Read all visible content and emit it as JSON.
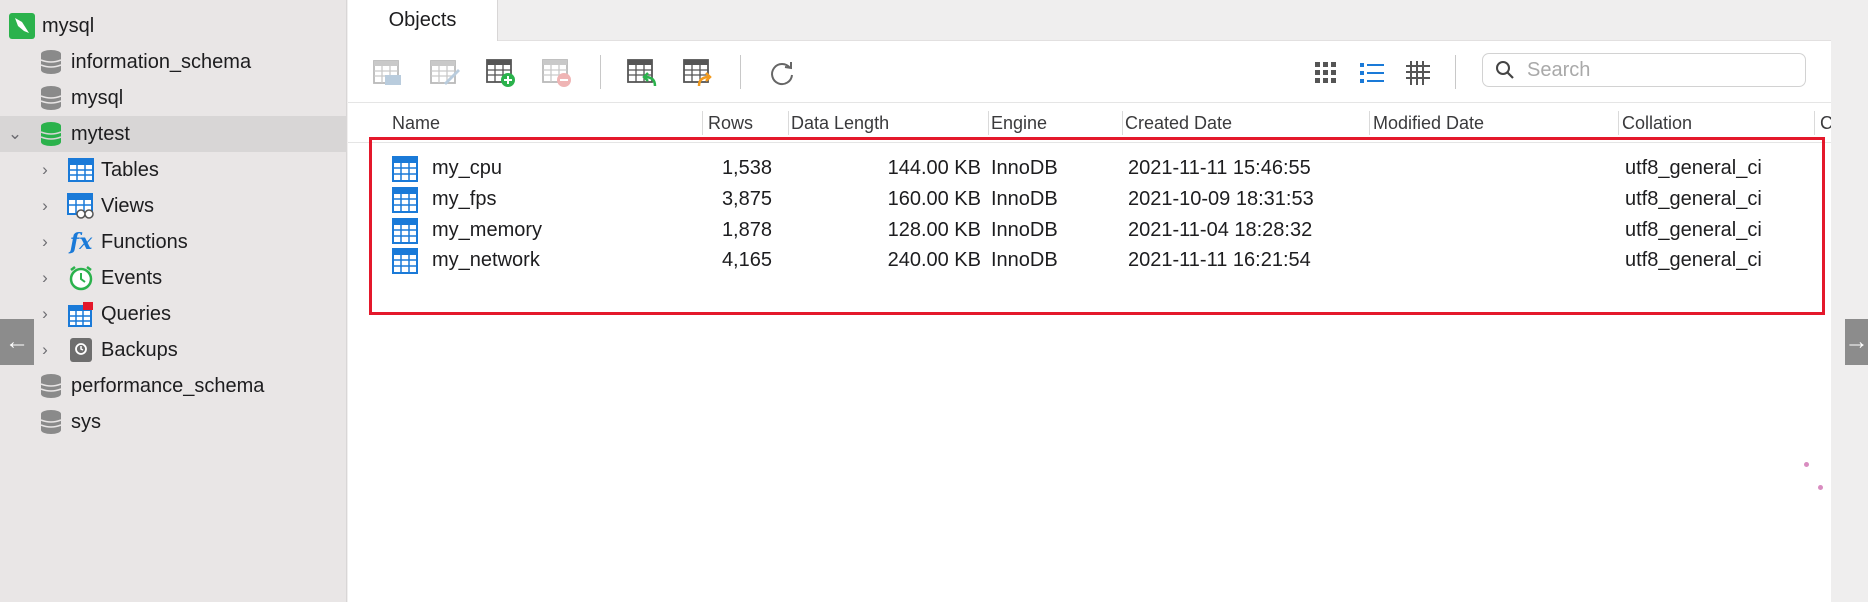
{
  "sidebar": {
    "items": [
      {
        "label": "mysql",
        "icon": "dolphin-connection-icon",
        "level": 0
      },
      {
        "label": "information_schema",
        "icon": "database-icon",
        "level": 1
      },
      {
        "label": "mysql",
        "icon": "database-icon",
        "level": 1
      },
      {
        "label": "mytest",
        "icon": "database-icon",
        "level": 1,
        "expanded": true,
        "selected": true
      },
      {
        "label": "Tables",
        "icon": "tables-icon",
        "level": 2
      },
      {
        "label": "Views",
        "icon": "views-icon",
        "level": 2
      },
      {
        "label": "Functions",
        "icon": "functions-icon",
        "level": 2
      },
      {
        "label": "Events",
        "icon": "events-icon",
        "level": 2
      },
      {
        "label": "Queries",
        "icon": "queries-icon",
        "level": 2
      },
      {
        "label": "Backups",
        "icon": "backups-icon",
        "level": 2
      },
      {
        "label": "performance_schema",
        "icon": "database-icon",
        "level": 1
      },
      {
        "label": "sys",
        "icon": "database-icon",
        "level": 1
      }
    ]
  },
  "tabs": {
    "objects": "Objects"
  },
  "toolbar": {
    "buttons": [
      "open-table-icon",
      "design-table-icon",
      "new-table-icon",
      "delete-table-icon",
      "import-wizard-icon",
      "export-wizard-icon",
      "refresh-icon"
    ],
    "views": [
      "icon-view-icon",
      "list-view-icon",
      "detail-view-icon"
    ],
    "search_placeholder": "Search"
  },
  "table": {
    "columns": [
      "Name",
      "Rows",
      "Data Length",
      "Engine",
      "Created Date",
      "Modified Date",
      "Collation",
      "C"
    ],
    "rows": [
      {
        "name": "my_cpu",
        "rows": "1,538",
        "data_length": "144.00 KB",
        "engine": "InnoDB",
        "created": "2021-11-11 15:46:55",
        "modified": "",
        "collation": "utf8_general_ci"
      },
      {
        "name": "my_fps",
        "rows": "3,875",
        "data_length": "160.00 KB",
        "engine": "InnoDB",
        "created": "2021-10-09 18:31:53",
        "modified": "",
        "collation": "utf8_general_ci"
      },
      {
        "name": "my_memory",
        "rows": "1,878",
        "data_length": "128.00 KB",
        "engine": "InnoDB",
        "created": "2021-11-04 18:28:32",
        "modified": "",
        "collation": "utf8_general_ci"
      },
      {
        "name": "my_network",
        "rows": "4,165",
        "data_length": "240.00 KB",
        "engine": "InnoDB",
        "created": "2021-11-11 16:21:54",
        "modified": "",
        "collation": "utf8_general_ci"
      }
    ]
  },
  "nav": {
    "left_arrow": "←",
    "right_arrow": "→"
  },
  "colors": {
    "highlight_border": "#e4182b",
    "accent_green": "#2bb24c",
    "accent_blue": "#1a7ad8"
  }
}
